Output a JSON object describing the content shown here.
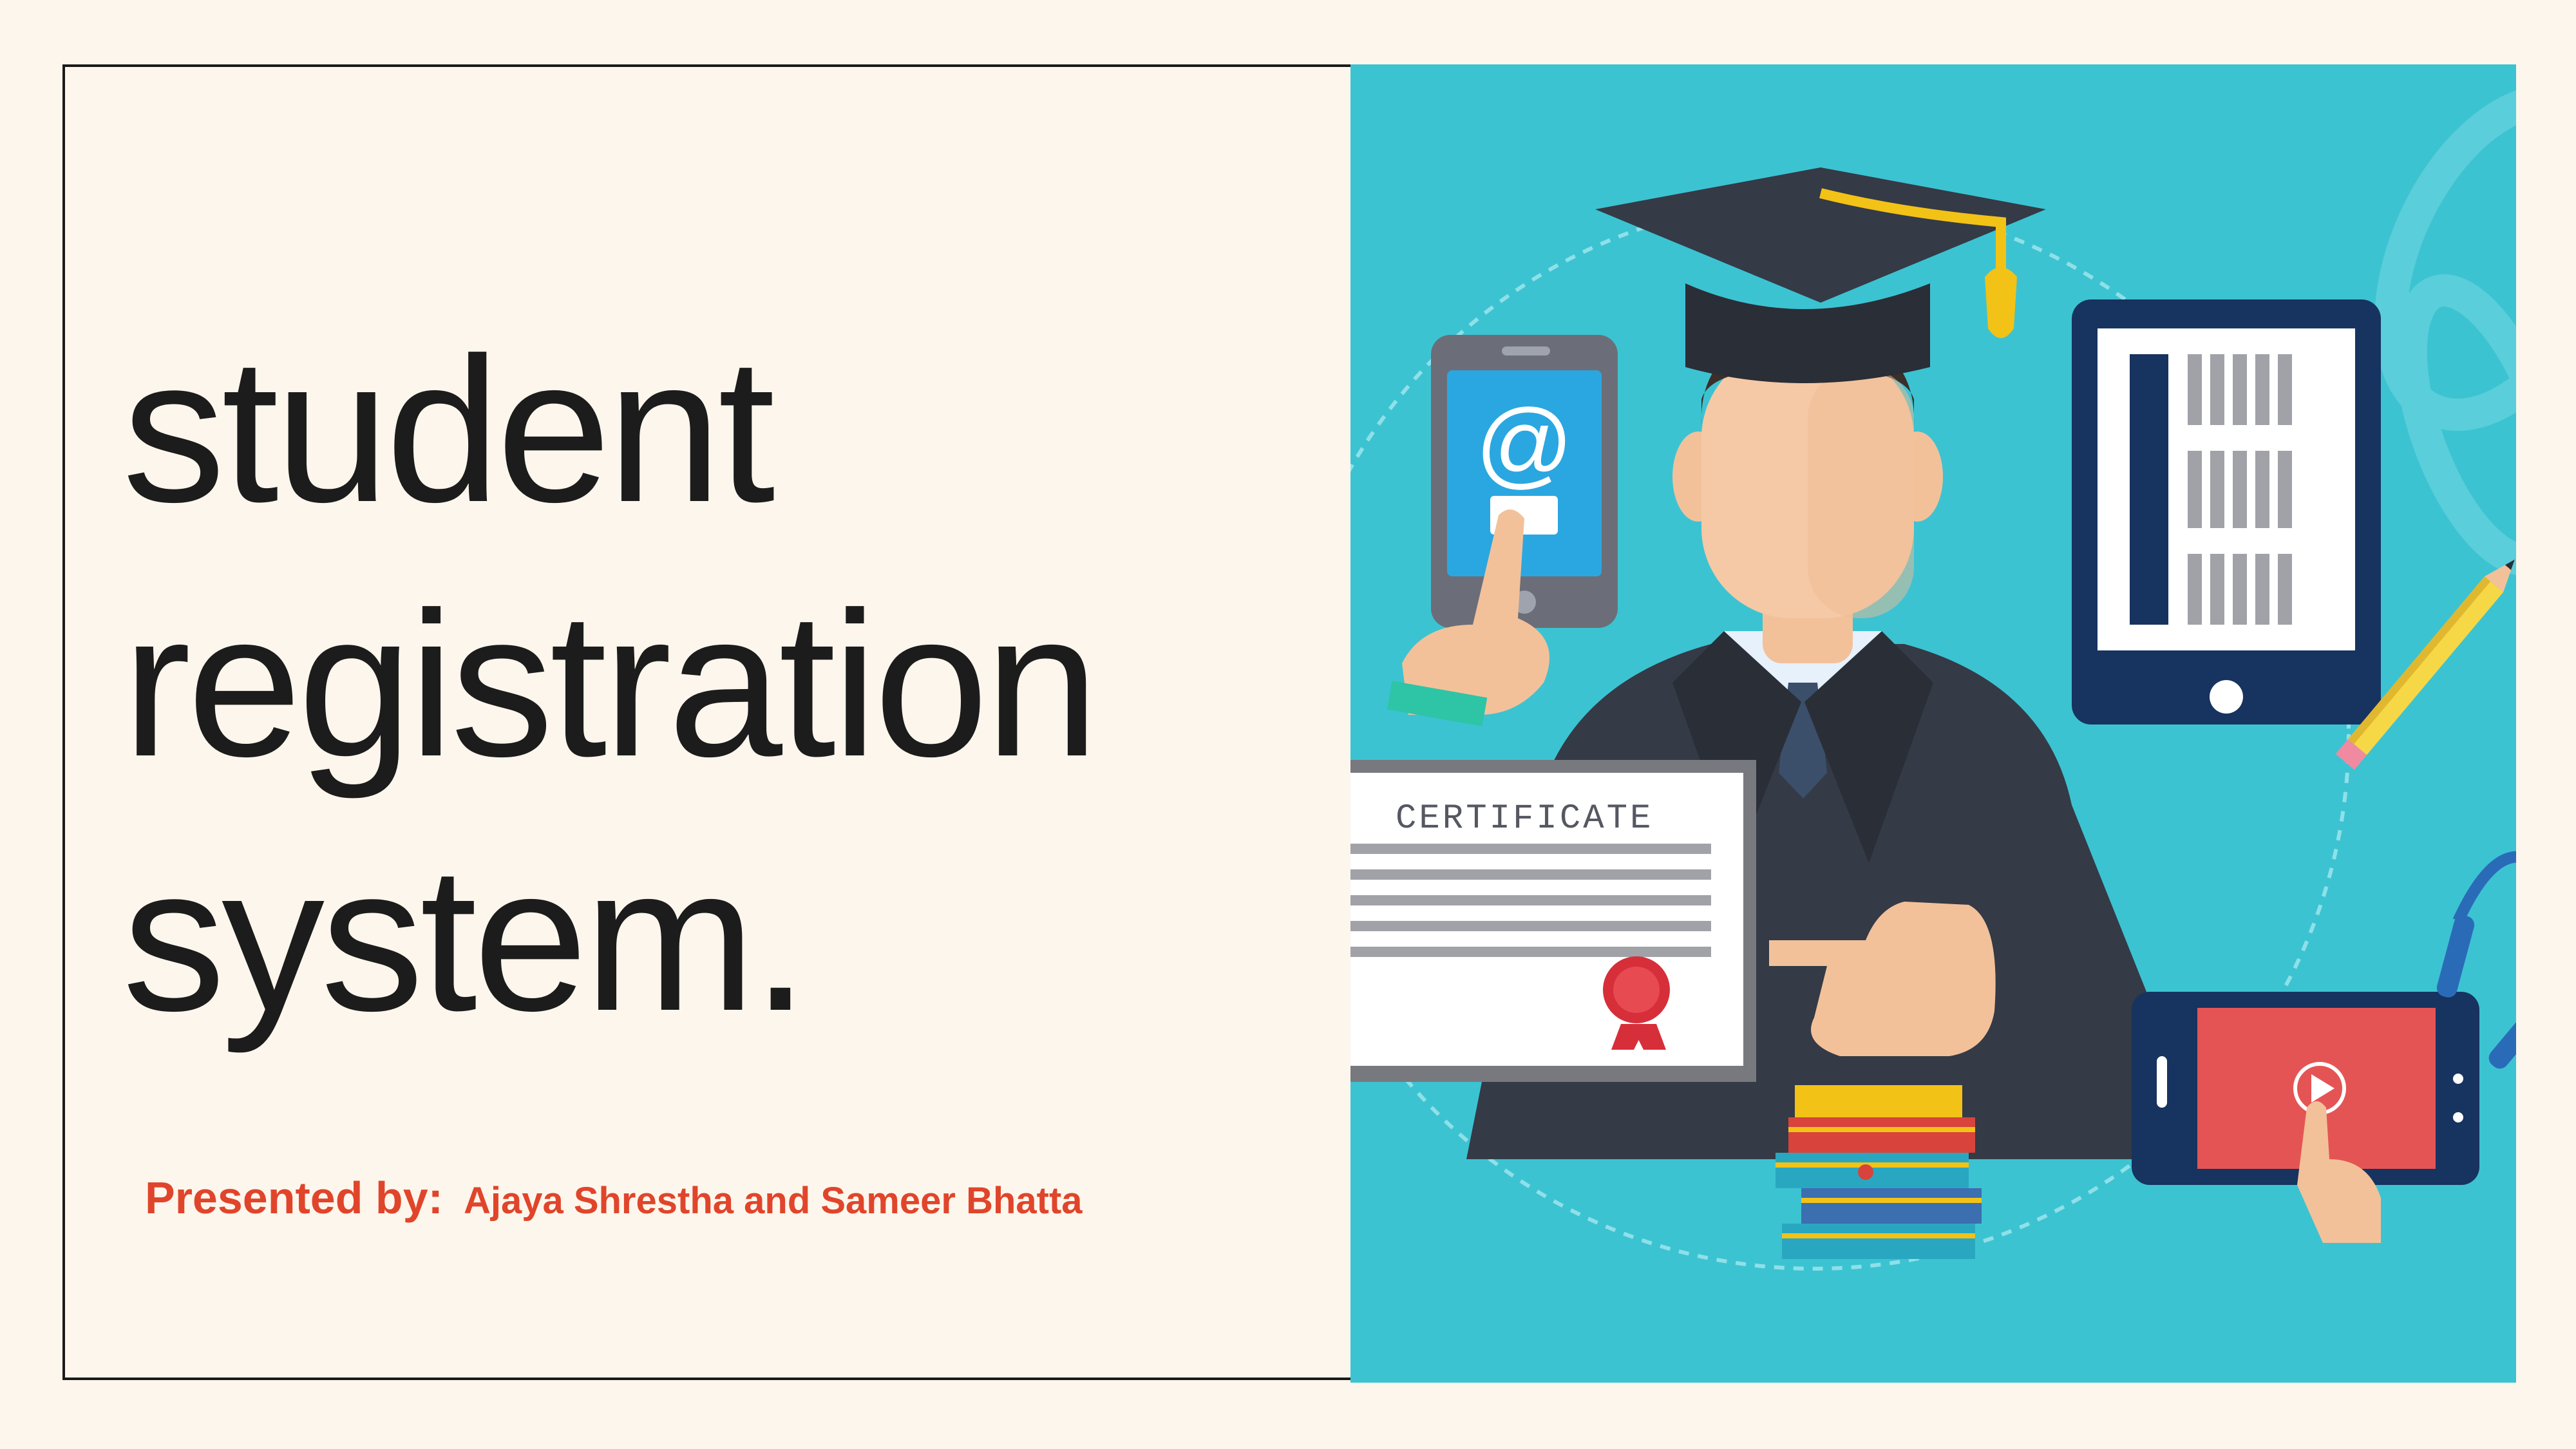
{
  "slide": {
    "title_lines": [
      "student",
      "registration",
      "system."
    ],
    "presented_by_label": "Presented by:",
    "presenters": "Ajaya Shrestha and Sameer Bhatta"
  },
  "illustration": {
    "certificate_title": "CERTIFICATE",
    "email_symbol": "@",
    "icons": [
      "graduate-icon",
      "graduation-cap-icon",
      "smartphone-icon",
      "tablet-icon",
      "pencil-icon",
      "certificate-icon",
      "ribbon-seal-icon",
      "books-icon",
      "video-tablet-icon",
      "headphones-icon"
    ]
  },
  "colors": {
    "background": "#fdf6ec",
    "title": "#1c1c1c",
    "accent": "#e0452b",
    "illustration_bg": "#3cc3d2"
  }
}
